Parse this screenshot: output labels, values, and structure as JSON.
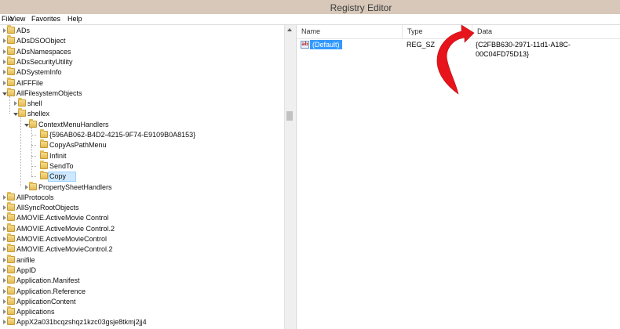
{
  "window": {
    "title": "Registry Editor"
  },
  "menu": [
    "File",
    "View",
    "Favorites",
    "Help"
  ],
  "tree": {
    "items": [
      {
        "label": "ADs",
        "level": 0,
        "expand": "collapsed"
      },
      {
        "label": "ADsDSOObject",
        "level": 0,
        "expand": "collapsed"
      },
      {
        "label": "ADsNamespaces",
        "level": 0,
        "expand": "collapsed"
      },
      {
        "label": "ADsSecurityUtility",
        "level": 0,
        "expand": "collapsed"
      },
      {
        "label": "ADSystemInfo",
        "level": 0,
        "expand": "collapsed"
      },
      {
        "label": "AIFFFile",
        "level": 0,
        "expand": "collapsed"
      },
      {
        "label": "AllFilesystemObjects",
        "level": 0,
        "expand": "expanded"
      },
      {
        "label": "shell",
        "level": 1,
        "expand": "collapsed"
      },
      {
        "label": "shellex",
        "level": 1,
        "expand": "expanded"
      },
      {
        "label": "ContextMenuHandlers",
        "level": 2,
        "expand": "expanded"
      },
      {
        "label": "{596AB062-B4D2-4215-9F74-E9109B0A8153}",
        "level": 3,
        "expand": "none"
      },
      {
        "label": "CopyAsPathMenu",
        "level": 3,
        "expand": "none"
      },
      {
        "label": "Infinit",
        "level": 3,
        "expand": "none"
      },
      {
        "label": "SendTo",
        "level": 3,
        "expand": "none"
      },
      {
        "label": "Copy",
        "level": 3,
        "expand": "none",
        "selected": true
      },
      {
        "label": "PropertySheetHandlers",
        "level": 2,
        "expand": "collapsed"
      },
      {
        "label": "AllProtocols",
        "level": 0,
        "expand": "collapsed"
      },
      {
        "label": "AllSyncRootObjects",
        "level": 0,
        "expand": "collapsed"
      },
      {
        "label": "AMOVIE.ActiveMovie Control",
        "level": 0,
        "expand": "collapsed"
      },
      {
        "label": "AMOVIE.ActiveMovie Control.2",
        "level": 0,
        "expand": "collapsed"
      },
      {
        "label": "AMOVIE.ActiveMovieControl",
        "level": 0,
        "expand": "collapsed"
      },
      {
        "label": "AMOVIE.ActiveMovieControl.2",
        "level": 0,
        "expand": "collapsed"
      },
      {
        "label": "anifile",
        "level": 0,
        "expand": "collapsed"
      },
      {
        "label": "AppID",
        "level": 0,
        "expand": "collapsed"
      },
      {
        "label": "Application.Manifest",
        "level": 0,
        "expand": "collapsed"
      },
      {
        "label": "Application.Reference",
        "level": 0,
        "expand": "collapsed"
      },
      {
        "label": "ApplicationContent",
        "level": 0,
        "expand": "collapsed"
      },
      {
        "label": "Applications",
        "level": 0,
        "expand": "collapsed"
      },
      {
        "label": "AppX2a031bcqzshqz1kzc03gsje8tkmj2jj4",
        "level": 0,
        "expand": "collapsed"
      }
    ]
  },
  "values": {
    "columns": [
      "Name",
      "Type",
      "Data"
    ],
    "rows": [
      {
        "name": "(Default)",
        "type": "REG_SZ",
        "data": "{C2FBB630-2971-11d1-A18C-00C04FD75D13}",
        "icon": "ab-string-icon"
      }
    ]
  },
  "colors": {
    "titlebar": "#d7c8b9",
    "selection": "#3399ff",
    "tree_selection": "#cde8ff",
    "annotation_arrow": "#e8141b"
  },
  "icons": [
    "folder-icon",
    "ab-string-icon",
    "red-curved-arrow-icon"
  ]
}
